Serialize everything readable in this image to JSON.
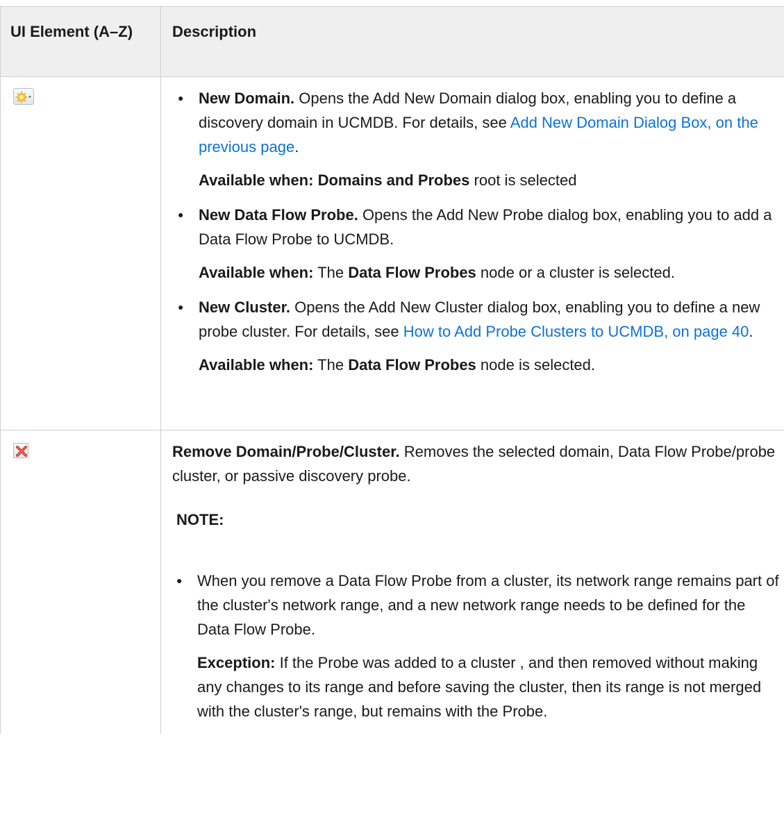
{
  "table": {
    "headers": {
      "ui_element": "UI Element (A–Z)",
      "description": "Description"
    },
    "rows": [
      {
        "icon": "new-star-dropdown-icon",
        "items": [
          {
            "title": "New Domain.",
            "text_before": " Opens the Add New Domain dialog box, enabling you to define a discovery domain in UCMDB. For details, see ",
            "link": "Add New Domain Dialog Box, on the previous page",
            "text_after": ".",
            "available_label": "Available when: ",
            "available_bold": "Domains and Probes",
            "available_rest": " root is selected"
          },
          {
            "title": "New Data Flow Probe.",
            "text_before": " Opens the Add New Probe dialog box, enabling you to add a Data Flow Probe to UCMDB.",
            "available_label": "Available when:",
            "available_pre": " The ",
            "available_bold": "Data Flow Probes",
            "available_rest": " node or a cluster is selected."
          },
          {
            "title": "New Cluster.",
            "text_before": " Opens the Add New Cluster dialog box, enabling you to define a new probe cluster. For details, see ",
            "link": "How to Add Probe Clusters to UCMDB, on page 40",
            "text_after": ".",
            "available_label": "Available when:",
            "available_pre": " The ",
            "available_bold": "Data Flow Probes",
            "available_rest": " node is selected."
          }
        ]
      },
      {
        "icon": "remove-x-icon",
        "title": "Remove Domain/Probe/Cluster.",
        "text": " Removes the selected domain, Data Flow Probe/probe cluster, or passive discovery probe.",
        "note_label": "NOTE:",
        "note_items": [
          {
            "text": "When you remove a Data Flow Probe from a cluster, its network range remains part of the cluster's network range, and a new network range needs to be defined for the Data Flow Probe.",
            "exception_label": "Exception:",
            "exception_text": " If the Probe was added to a cluster , and then removed without making any changes to its range and before saving the cluster, then its range is not merged with the cluster's range, but remains with the Probe."
          }
        ]
      }
    ]
  },
  "colors": {
    "link": "#0d73d2",
    "header_bg": "#efefef",
    "border": "#cfcfcf"
  }
}
